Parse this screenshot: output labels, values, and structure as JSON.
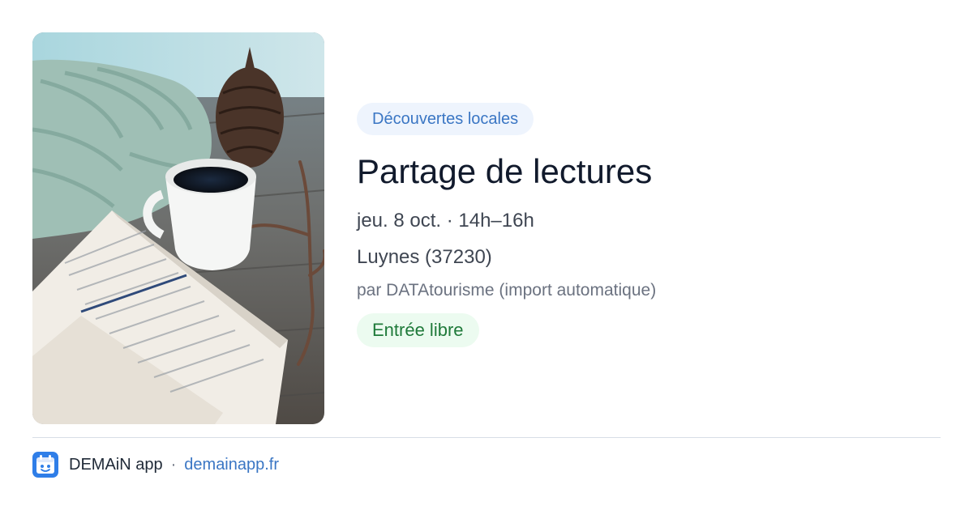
{
  "event": {
    "category": "Découvertes locales",
    "title": "Partage de lectures",
    "datetime": "jeu. 8 oct. · 14h–16h",
    "location": "Luynes (37230)",
    "source": "par DATAtourisme (import automatique)",
    "price": "Entrée libre",
    "image_alt": "Livre ouvert, tasse de café, pomme de pin et écharpe en laine sur une table en bois"
  },
  "footer": {
    "app_name": "DEMAiN app",
    "separator": "·",
    "site": "demainapp.fr"
  },
  "colors": {
    "category_bg": "#eef4fd",
    "category_text": "#3a76c4",
    "price_bg": "#ecfbf0",
    "price_text": "#1f7a3a",
    "link": "#3a76c4",
    "app_icon": "#2f7ee8"
  },
  "icons": {
    "app": "demain-app-icon"
  }
}
